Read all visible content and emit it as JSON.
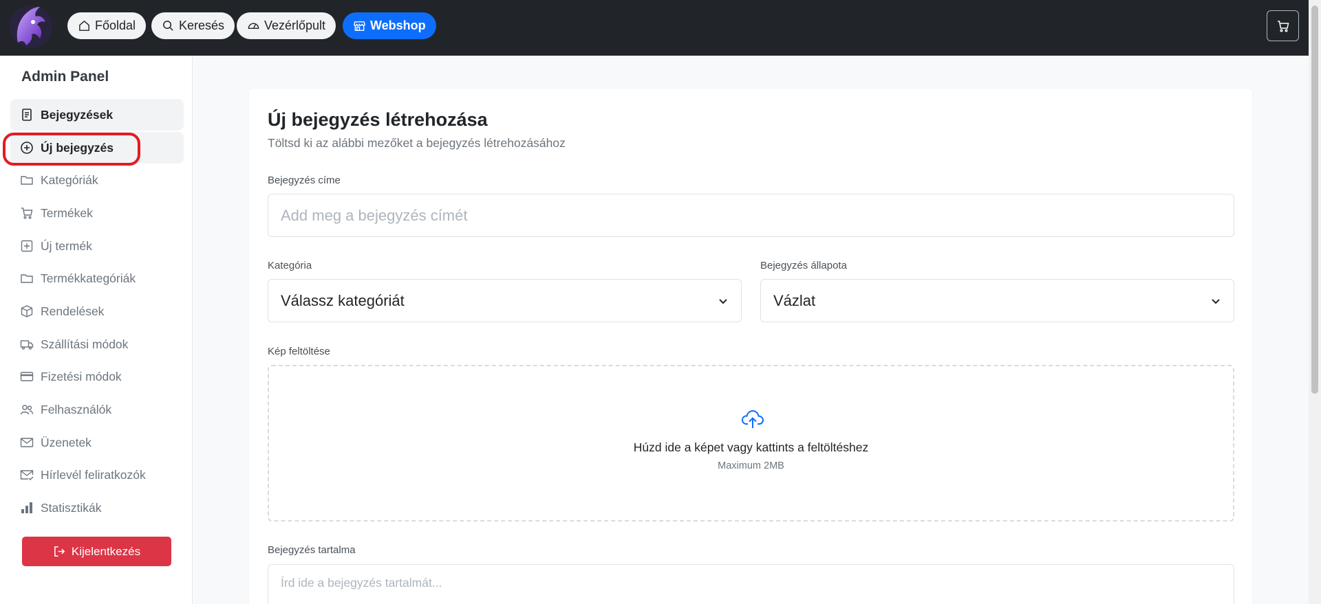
{
  "topnav": {
    "home_label": "Főoldal",
    "search_label": "Keresés",
    "dashboard_label": "Vezérlőpult",
    "webshop_label": "Webshop",
    "primary_color": "#0d6efd"
  },
  "sidebar": {
    "title": "Admin Panel",
    "items": [
      {
        "label": "Bejegyzések",
        "icon": "document-icon"
      },
      {
        "label": "Új bejegyzés",
        "icon": "plus-circle-icon"
      },
      {
        "label": "Kategóriák",
        "icon": "folder-icon"
      },
      {
        "label": "Termékek",
        "icon": "cart-icon"
      },
      {
        "label": "Új termék",
        "icon": "plus-square-icon"
      },
      {
        "label": "Termékkategóriák",
        "icon": "folder-icon"
      },
      {
        "label": "Rendelések",
        "icon": "box-icon"
      },
      {
        "label": "Szállítási módok",
        "icon": "truck-icon"
      },
      {
        "label": "Fizetési módok",
        "icon": "credit-card-icon"
      },
      {
        "label": "Felhasználók",
        "icon": "users-icon"
      },
      {
        "label": "Üzenetek",
        "icon": "envelope-icon"
      },
      {
        "label": "Hírlevél feliratkozók",
        "icon": "envelope-check-icon"
      },
      {
        "label": "Statisztikák",
        "icon": "bar-chart-icon"
      }
    ],
    "logout_label": "Kijelentkezés",
    "logout_color": "#dc3545"
  },
  "form": {
    "title": "Új bejegyzés létrehozása",
    "subtitle": "Töltsd ki az alábbi mezőket a bejegyzés létrehozásához",
    "post_title_label": "Bejegyzés címe",
    "post_title_placeholder": "Add meg a bejegyzés címét",
    "category_label": "Kategória",
    "category_value": "Válassz kategóriát",
    "status_label": "Bejegyzés állapota",
    "status_value": "Vázlat",
    "image_label": "Kép feltöltése",
    "upload_text": "Húzd ide a képet vagy kattints a feltöltéshez",
    "upload_limit": "Maximum 2MB",
    "content_label": "Bejegyzés tartalma",
    "content_placeholder": "Írd ide a bejegyzés tartalmát..."
  }
}
